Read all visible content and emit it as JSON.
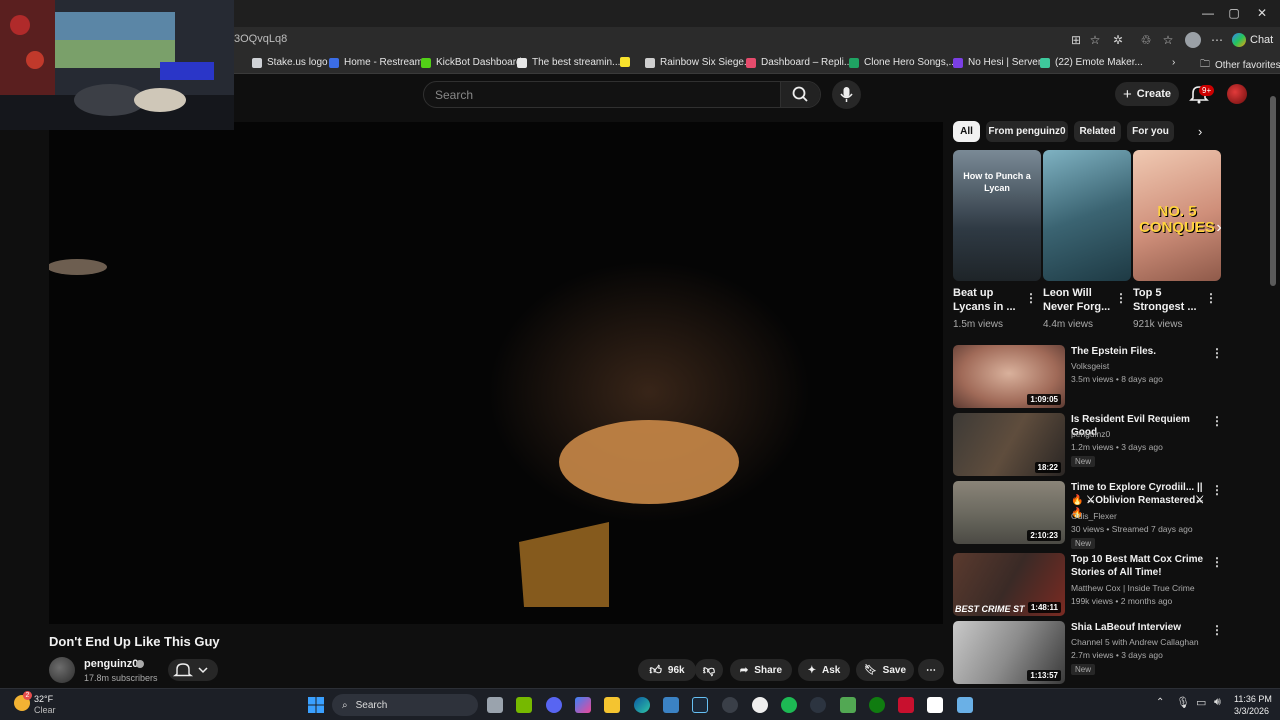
{
  "browser": {
    "url": "3OQvqLq8",
    "chat_label": "Chat",
    "other_favorites": "Other favorites",
    "favorites": [
      {
        "label": "Stake.us logo",
        "color": "#cfd2d6"
      },
      {
        "label": "Home - Restream",
        "color": "#3b6de6"
      },
      {
        "label": "KickBot Dashboard",
        "color": "#52d017"
      },
      {
        "label": "The best streamin...",
        "color": "#e6e6e6"
      },
      {
        "label": "",
        "color": "#f7e22d"
      },
      {
        "label": "Rainbow Six Siege...",
        "color": "#cfcfcf"
      },
      {
        "label": "Dashboard – Repli...",
        "color": "#e54b6c"
      },
      {
        "label": "Clone Hero Songs,...",
        "color": "#1fa463"
      },
      {
        "label": "No Hesi | Servers",
        "color": "#7b3fe4"
      },
      {
        "label": "(22) Emote Maker...",
        "color": "#3ec89c"
      }
    ]
  },
  "masthead": {
    "search_placeholder": "Search",
    "create_label": "Create",
    "notif_count": "9+"
  },
  "video": {
    "title": "Don't End Up Like This Guy",
    "channel": "penguinz0",
    "subscribers": "17.8m subscribers",
    "likes": "96k",
    "share_label": "Share",
    "ask_label": "Ask",
    "save_label": "Save"
  },
  "chips": [
    "All",
    "From penguinz0",
    "Related",
    "For you"
  ],
  "shorts": [
    {
      "title": "Beat up Lycans in ...",
      "views": "1.5m views",
      "overlay": "How to Punch a Lycan"
    },
    {
      "title": "Leon Will Never Forg...",
      "views": "4.4m views",
      "overlay": ""
    },
    {
      "title": "Top 5 Strongest ...",
      "views": "921k views",
      "overlay": "NO. 5 CONQUES"
    }
  ],
  "recommendations": [
    {
      "title": "The Epstein Files.",
      "channel": "Volksgeist",
      "meta": "3.5m views • 8 days ago",
      "duration": "1:09:05",
      "badge": ""
    },
    {
      "title": "Is Resident Evil Requiem Good",
      "channel": "penguinz0",
      "meta": "1.2m views • 3 days ago",
      "duration": "18:22",
      "badge": "New"
    },
    {
      "title": "Time to Explore Cyrodiil... || 🔥 ⚔Oblivion Remastered⚔ 🔥",
      "channel": "Odis_Flexer",
      "meta": "30 views • Streamed 7 days ago",
      "duration": "2:10:23",
      "badge": "New"
    },
    {
      "title": "Top 10 Best Matt Cox Crime Stories of All Time!",
      "channel": "Matthew Cox | Inside True Crime",
      "meta": "199k views • 2 months ago",
      "duration": "1:48:11",
      "badge": "",
      "overlay": "BEST CRIME ST"
    },
    {
      "title": "Shia LaBeouf Interview",
      "channel": "Channel 5 with Andrew Callaghan",
      "meta": "2.7m views • 3 days ago",
      "duration": "1:13:57",
      "badge": "New"
    }
  ],
  "taskbar": {
    "temp": "32°F",
    "condition": "Clear",
    "search_label": "Search",
    "time": "11:36 PM",
    "date": "3/3/2026",
    "weather_badge": "2"
  }
}
